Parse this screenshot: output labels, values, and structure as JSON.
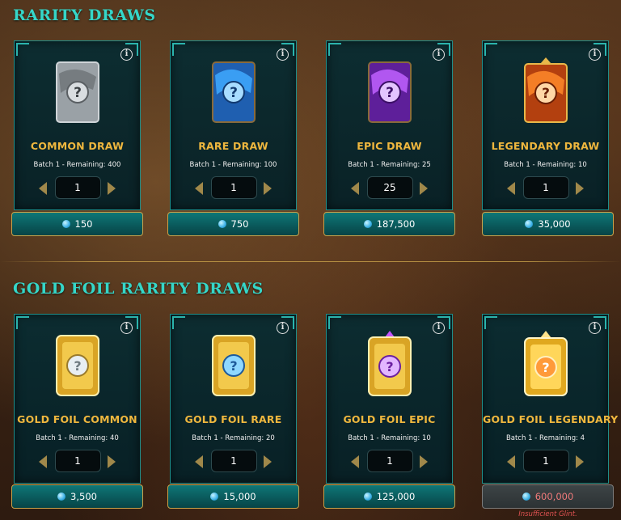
{
  "sections": {
    "rarity_title": "RARITY DRAWS",
    "gold_foil_title": "GOLD FOIL RARITY DRAWS"
  },
  "rarity_cards": [
    {
      "title": "COMMON DRAW",
      "batch": "Batch 1 - Remaining: 400",
      "quantity": "1",
      "price": "150",
      "color": "#b9bec2"
    },
    {
      "title": "RARE DRAW",
      "batch": "Batch 1 - Remaining: 100",
      "quantity": "1",
      "price": "750",
      "color": "#2f8fe6"
    },
    {
      "title": "EPIC DRAW",
      "batch": "Batch 1 - Remaining: 25",
      "quantity": "25",
      "price": "187,500",
      "color": "#9a3ad8"
    },
    {
      "title": "LEGENDARY DRAW",
      "batch": "Batch 1 - Remaining: 10",
      "quantity": "1",
      "price": "35,000",
      "color": "#e0661c"
    }
  ],
  "gold_cards": [
    {
      "title": "GOLD FOIL COMMON",
      "batch": "Batch 1 - Remaining: 40",
      "quantity": "1",
      "price": "3,500",
      "color": "#b9bec2"
    },
    {
      "title": "GOLD FOIL RARE",
      "batch": "Batch 1 - Remaining: 20",
      "quantity": "1",
      "price": "15,000",
      "color": "#2f8fe6"
    },
    {
      "title": "GOLD FOIL EPIC",
      "batch": "Batch 1 - Remaining: 10",
      "quantity": "1",
      "price": "125,000",
      "color": "#9a3ad8"
    },
    {
      "title": "GOLD FOIL LEGENDARY",
      "batch": "Batch 1 - Remaining: 4",
      "quantity": "1",
      "price": "600,000",
      "color": "#f0c04a"
    }
  ],
  "info_glyph": "i",
  "warning": "Insufficient Glint.",
  "icons": {
    "currency": "glint-icon",
    "info": "info-icon",
    "decrement": "arrow-left-icon",
    "increment": "arrow-right-icon"
  }
}
